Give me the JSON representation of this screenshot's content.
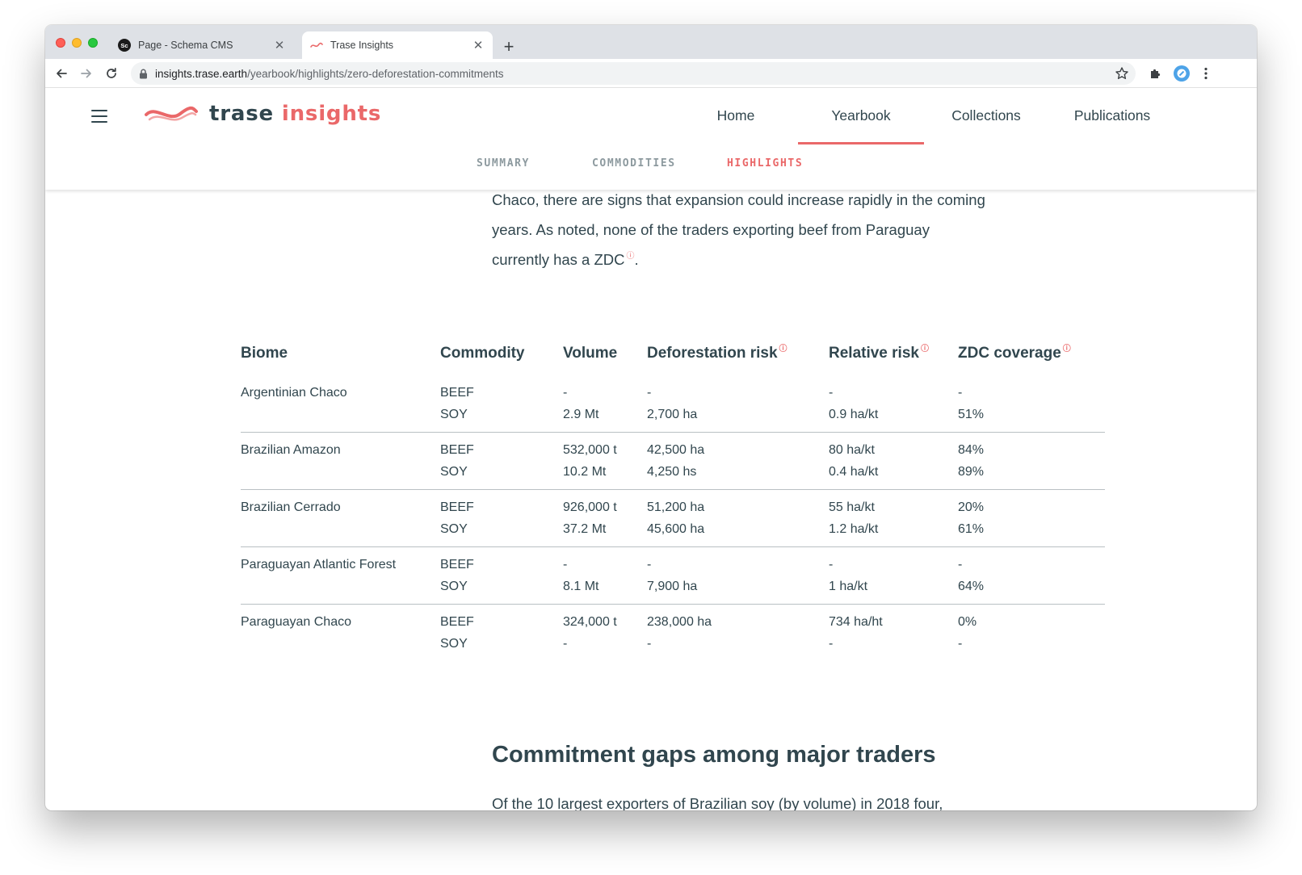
{
  "browser": {
    "tabs": [
      {
        "title": "Page - Schema CMS",
        "favicon": "sc-icon"
      },
      {
        "title": "Trase Insights",
        "favicon": "trase-wave-icon"
      }
    ],
    "url_host": "insights.trase.earth",
    "url_path": "/yearbook/highlights/zero-deforestation-commitments",
    "colors": {
      "tabstrip": "#dee1e6",
      "omnibox": "#f1f3f4"
    }
  },
  "site": {
    "logo_word1": "trase",
    "logo_word2": "insights",
    "nav": [
      {
        "label": "Home",
        "active": false
      },
      {
        "label": "Yearbook",
        "active": true
      },
      {
        "label": "Collections",
        "active": false
      },
      {
        "label": "Publications",
        "active": false
      }
    ],
    "subnav": [
      {
        "label": "SUMMARY",
        "active": false
      },
      {
        "label": "COMMODITIES",
        "active": false
      },
      {
        "label": "HIGHLIGHTS",
        "active": true
      }
    ],
    "colors": {
      "accent": "#ea6869",
      "text": "#31464e"
    }
  },
  "article": {
    "intro_clipped": "Chaco, there are signs that expansion could increase rapidly in the coming",
    "intro_line2": "years. As noted, none of the traders exporting beef from Paraguay",
    "intro_line3": "currently has a ZDC",
    "intro_end": ".",
    "info_mark": "ⓘ",
    "section_title": "Commitment gaps among major traders",
    "section_para": "Of the 10 largest exporters of Brazilian soy (by volume) in 2018 four,"
  },
  "table": {
    "headers": {
      "biome": "Biome",
      "commodity": "Commodity",
      "volume": "Volume",
      "deforestation": "Deforestation risk",
      "relative": "Relative risk",
      "zdc": "ZDC coverage"
    },
    "rows": [
      {
        "biome": "Argentinian Chaco",
        "items": [
          {
            "commodity": "BEEF",
            "volume": "-",
            "deforestation": "-",
            "relative": "-",
            "zdc": "-"
          },
          {
            "commodity": "SOY",
            "volume": "2.9 Mt",
            "deforestation": "2,700 ha",
            "relative": "0.9 ha/kt",
            "zdc": "51%"
          }
        ]
      },
      {
        "biome": "Brazilian Amazon",
        "items": [
          {
            "commodity": "BEEF",
            "volume": "532,000 t",
            "deforestation": "42,500 ha",
            "relative": "80 ha/kt",
            "zdc": "84%"
          },
          {
            "commodity": "SOY",
            "volume": "10.2 Mt",
            "deforestation": "4,250 hs",
            "relative": "0.4 ha/kt",
            "zdc": "89%"
          }
        ]
      },
      {
        "biome": "Brazilian Cerrado",
        "items": [
          {
            "commodity": "BEEF",
            "volume": "926,000 t",
            "deforestation": "51,200 ha",
            "relative": "55 ha/kt",
            "zdc": "20%"
          },
          {
            "commodity": "SOY",
            "volume": "37.2 Mt",
            "deforestation": "45,600 ha",
            "relative": "1.2 ha/kt",
            "zdc": "61%"
          }
        ]
      },
      {
        "biome": "Paraguayan Atlantic Forest",
        "items": [
          {
            "commodity": "BEEF",
            "volume": "-",
            "deforestation": "-",
            "relative": "-",
            "zdc": "-"
          },
          {
            "commodity": "SOY",
            "volume": "8.1 Mt",
            "deforestation": "7,900 ha",
            "relative": "1 ha/kt",
            "zdc": "64%"
          }
        ]
      },
      {
        "biome": "Paraguayan Chaco",
        "items": [
          {
            "commodity": "BEEF",
            "volume": "324,000 t",
            "deforestation": "238,000 ha",
            "relative": "734 ha/ht",
            "zdc": "0%"
          },
          {
            "commodity": "SOY",
            "volume": "-",
            "deforestation": "-",
            "relative": "-",
            "zdc": "-"
          }
        ]
      }
    ]
  }
}
